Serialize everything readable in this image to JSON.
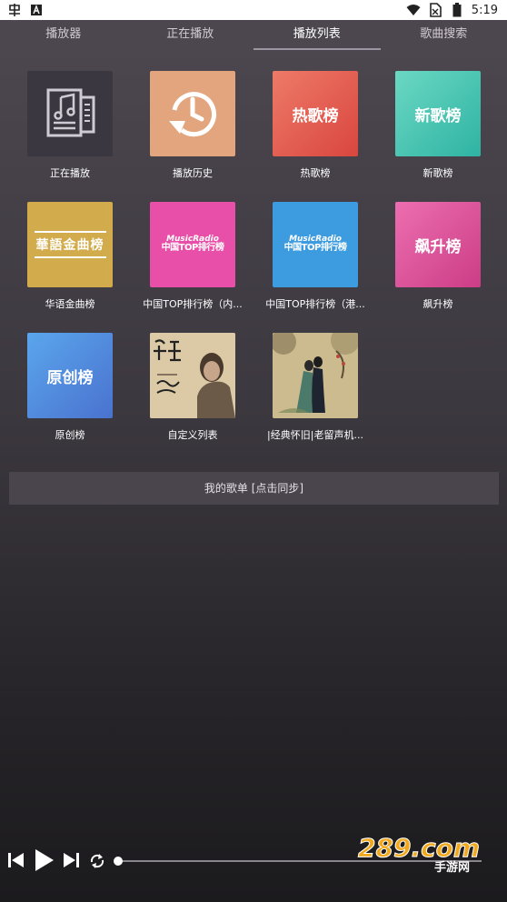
{
  "status_bar": {
    "time": "5:19",
    "left_icons": [
      "app-notification-icon",
      "a-badge-icon"
    ],
    "right_icons": [
      "wifi-icon",
      "no-sim-icon",
      "battery-icon"
    ]
  },
  "tabs": [
    {
      "label": "播放器",
      "active": false
    },
    {
      "label": "正在播放",
      "active": false
    },
    {
      "label": "播放列表",
      "active": true
    },
    {
      "label": "歌曲搜索",
      "active": false
    }
  ],
  "tiles": [
    {
      "label": "正在播放",
      "art": "music-doc-icon",
      "color": "#3a3740"
    },
    {
      "label": "播放历史",
      "art": "history-clock-icon",
      "color": "#e2a57e"
    },
    {
      "label": "热歌榜",
      "art_text": "热歌榜",
      "color": "#e05a4f"
    },
    {
      "label": "新歌榜",
      "art_text": "新歌榜",
      "color": "#3cc0ae"
    },
    {
      "label": "华语金曲榜",
      "art_text": "華語金曲榜",
      "color": "#d2ac4c"
    },
    {
      "label": "中国TOP排行榜（内...",
      "art_top": "MusicRadio",
      "art_bottom": "中国TOP排行榜",
      "color": "#e84fa8"
    },
    {
      "label": "中国TOP排行榜（港...",
      "art_top": "MusicRadio",
      "art_bottom": "中国TOP排行榜",
      "color": "#3d9be0"
    },
    {
      "label": "飙升榜",
      "art_text": "飙升榜",
      "color": "#d9529a"
    },
    {
      "label": "原创榜",
      "art_text": "原创榜",
      "color": "#4f8fdd"
    },
    {
      "label": "自定义列表",
      "art": "album-cover-portrait",
      "color": "#d9c7a3"
    },
    {
      "label": "|经典怀旧|老留声机...",
      "art": "album-cover-painting",
      "color": "#c9b78c"
    }
  ],
  "my_list": {
    "label": "我的歌单 [点击同步]"
  },
  "player": {
    "controls": [
      "previous-icon",
      "play-icon",
      "next-icon",
      "repeat-icon"
    ],
    "progress": 0.0
  },
  "watermark": {
    "text": "289.com",
    "sub": "手游网"
  }
}
